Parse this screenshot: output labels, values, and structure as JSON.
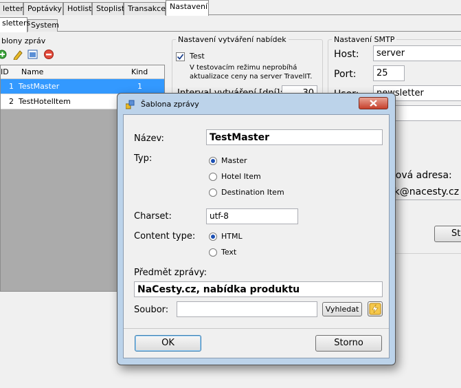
{
  "tabs": [
    "letters",
    "Poptávky",
    "Hotlist",
    "Stoplist",
    "Transakce",
    "Nastavení"
  ],
  "subtabs": [
    "sletters",
    "System"
  ],
  "left": {
    "title": "blony zpráv",
    "columns": [
      "ID",
      "Name",
      "Kind"
    ],
    "rows": [
      {
        "id": "1",
        "name": "TestMaster",
        "kind": "1"
      },
      {
        "id": "2",
        "name": "TestHotelItem",
        "kind": ""
      }
    ]
  },
  "offers": {
    "title": "Nastavení vytváření nabídek",
    "test_label": "Test",
    "test_desc_1": "V testovacím režimu neprobíhá",
    "test_desc_2": "aktualizace ceny na server TravelIT.",
    "interval_label": "Interval vytváření [dní]:",
    "interval_value": "30"
  },
  "smtp": {
    "title": "Nastavení SMTP",
    "host_label": "Host:",
    "host_value": "server",
    "port_label": "Port:",
    "port_value": "25",
    "user_label": "User:",
    "user_value": "newsletter",
    "password_value": "•••",
    "email_label": "ilová adresa:",
    "email_value": "ek@nacesty.cz",
    "save_label": "St"
  },
  "dialog": {
    "title": "Šablona zprávy",
    "name_label": "Název:",
    "name_value": "TestMaster",
    "type_label": "Typ:",
    "type_options": [
      "Master",
      "Hotel Item",
      "Destination Item"
    ],
    "charset_label": "Charset:",
    "charset_value": "utf-8",
    "content_label": "Content type:",
    "content_options": [
      "HTML",
      "Text"
    ],
    "subject_label": "Předmět zprávy:",
    "subject_value": "NaCesty.cz, nabídka produktu",
    "file_label": "Soubor:",
    "file_value": "",
    "browse_label": "Vyhledat",
    "ok_label": "OK",
    "cancel_label": "Storno"
  }
}
